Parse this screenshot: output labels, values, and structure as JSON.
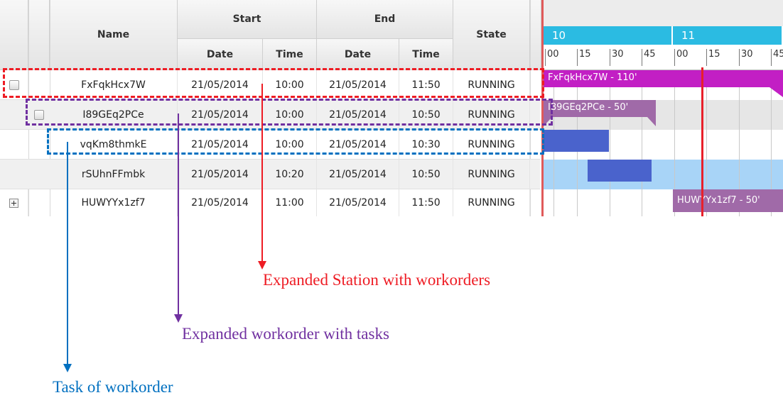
{
  "table": {
    "headers": {
      "name": "Name",
      "start": "Start",
      "end": "End",
      "state": "State",
      "date": "Date",
      "time": "Time"
    },
    "rows": [
      {
        "name": "FxFqkHcx7W",
        "start_date": "21/05/2014",
        "start_time": "10:00",
        "end_date": "21/05/2014",
        "end_time": "11:50",
        "state": "RUNNING",
        "control": "checkbox"
      },
      {
        "name": "I89GEq2PCe",
        "start_date": "21/05/2014",
        "start_time": "10:00",
        "end_date": "21/05/2014",
        "end_time": "10:50",
        "state": "RUNNING",
        "control": "checkbox"
      },
      {
        "name": "vqKm8thmkE",
        "start_date": "21/05/2014",
        "start_time": "10:00",
        "end_date": "21/05/2014",
        "end_time": "10:30",
        "state": "RUNNING",
        "control": "none"
      },
      {
        "name": "rSUhnFFmbk",
        "start_date": "21/05/2014",
        "start_time": "10:20",
        "end_date": "21/05/2014",
        "end_time": "10:50",
        "state": "RUNNING",
        "control": "none"
      },
      {
        "name": "HUWYYx1zf7",
        "start_date": "21/05/2014",
        "start_time": "11:00",
        "end_date": "21/05/2014",
        "end_time": "11:50",
        "state": "RUNNING",
        "control": "expand"
      }
    ]
  },
  "gantt": {
    "hours": [
      "10",
      "11"
    ],
    "ticks": [
      "00",
      "15",
      "30",
      "45",
      "00",
      "15",
      "30",
      "45"
    ],
    "bars": {
      "row1_label": "FxFqkHcx7W - 110'",
      "row2_label": "I89GEq2PCe - 50'",
      "row5_label": "HUWYYx1zf7 - 50'"
    },
    "colors": {
      "hour_band": "#2bbbe2",
      "station_bar": "#c21fc4",
      "workorder_bar": "#a06aa8",
      "task_bar": "#4a63cc",
      "task_row_highlight": "#a8d4f7",
      "now_line": "#e8202a"
    }
  },
  "annotations": {
    "station": "Expanded Station with workorders",
    "workorder": "Expanded workorder with tasks",
    "task": "Task of workorder",
    "colors": {
      "station": "#ee1c24",
      "workorder": "#7030a0",
      "task": "#0070c0"
    }
  }
}
